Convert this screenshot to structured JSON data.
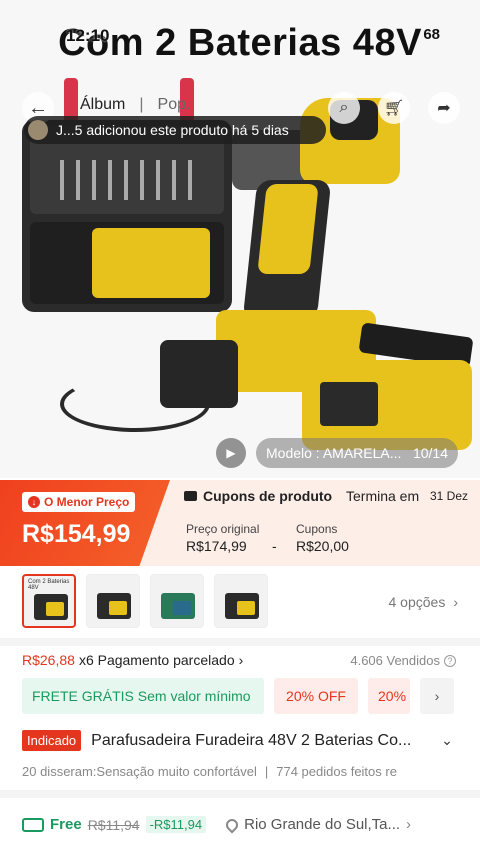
{
  "hero": {
    "title": "Com 2 Baterias 48V",
    "status_time": "12:10",
    "status_right": "68",
    "tab_album": "Álbum",
    "tab_sep": "|",
    "tab_pop": "Pop.",
    "toast_text": "J...5 adicionou este produto há 5 dias",
    "model_label": "Modelo : AMARELA...",
    "image_counter": "10/14"
  },
  "price": {
    "lowest_badge": "O Menor Preço",
    "current": "R$154,99",
    "coupons_title": "Cupons de produto",
    "ends_label": "Termina em",
    "ends_date": "31 Dez",
    "original_label": "Preço original",
    "original_value": "R$174,99",
    "minus": "-",
    "coupons_label": "Cupons",
    "coupons_value": "R$20,00"
  },
  "thumbs": {
    "first_caption": "Com 2 Baterias 48V",
    "options": "4 opções"
  },
  "install": {
    "price": "R$26,88",
    "text": "x6 Pagamento parcelado",
    "sold": "4.606 Vendidos"
  },
  "chips": {
    "free_shipping": "FRETE GRÁTIS Sem valor mínimo",
    "off1": "20% OFF",
    "off2": "20%"
  },
  "product": {
    "tag": "Indicado",
    "title": "Parafusadeira Furadeira 48V 2 Baterias Co..."
  },
  "reviews": {
    "said": "20 disseram:Sensação muito confortável",
    "sep": "|",
    "orders": "774 pedidos feitos re"
  },
  "shipping": {
    "free": "Free",
    "old_price": "R$11,94",
    "discount": "-R$11,94",
    "location": "Rio Grande do Sul,Ta..."
  },
  "colors": {
    "accent": "#e4361e",
    "green": "#1a9a5e",
    "product_yellow": "#e8c21c"
  }
}
